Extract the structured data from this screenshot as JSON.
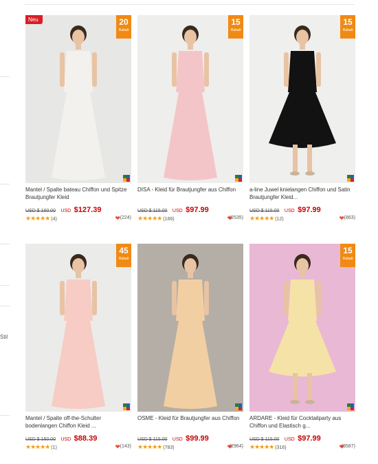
{
  "sidebar": {
    "fragment": "Stil"
  },
  "products": [
    {
      "title": "Mantel / Spalte bateau Chiffon und Spitze Brautjungfer Kleid",
      "old_price": "USD $ 160.00",
      "currency": "USD",
      "price": "$127.39",
      "reviews": "(4)",
      "likes": "(224)",
      "discount": "20",
      "discount_label": "Rabatt",
      "new_label": "Neu",
      "rating": 5,
      "dress_color": "#f3f1ee",
      "bg_color": "#e7e7e5"
    },
    {
      "title": "DISA - Kleid für Brautjungfer aus Chiffon",
      "old_price": "USD $ 115.00",
      "currency": "USD",
      "price": "$97.99",
      "reviews": "(166)",
      "likes": "(2535)",
      "discount": "15",
      "discount_label": "Rabatt",
      "new_label": "",
      "rating": 5,
      "dress_color": "#f4c5c8",
      "bg_color": "#eeeeec"
    },
    {
      "title": "a-line Juwel knielangen Chiffon und Satin Brautjungfer Kleid...",
      "old_price": "USD $ 115.00",
      "currency": "USD",
      "price": "$97.99",
      "reviews": "(12)",
      "likes": "(863)",
      "discount": "15",
      "discount_label": "Rabatt",
      "new_label": "",
      "rating": 5,
      "dress_color": "#121212",
      "bg_color": "#efefed"
    },
    {
      "title": "Mantel / Spalte off-the-Schulter bodenlangen Chiffon Kleid ...",
      "old_price": "USD $ 160.00",
      "currency": "USD",
      "price": "$88.39",
      "reviews": "(1)",
      "likes": "(143)",
      "discount": "45",
      "discount_label": "Rabatt",
      "new_label": "",
      "rating": 5,
      "dress_color": "#f6ccc4",
      "bg_color": "#ebebea"
    },
    {
      "title": "OSME - Kleid für Brautjungfer aus Chiffon",
      "old_price": "USD $ 115.00",
      "currency": "USD",
      "price": "$99.99",
      "reviews": "(783)",
      "likes": "(2964)",
      "discount": "",
      "discount_label": "",
      "new_label": "",
      "rating": 5,
      "dress_color": "#f2cfa3",
      "bg_color": "#b4aea6"
    },
    {
      "title": "ARDARE - Kleid für Cocktailparty aus Chiffon und Elastisch g...",
      "old_price": "USD $ 115.00",
      "currency": "USD",
      "price": "$97.99",
      "reviews": "(316)",
      "likes": "(3587)",
      "discount": "15",
      "discount_label": "Rabatt",
      "new_label": "",
      "rating": 5,
      "dress_color": "#f5e2a6",
      "bg_color": "#e9b8d5"
    }
  ],
  "colors": {
    "accent": "#f08a14",
    "price": "#cc0000",
    "new_tag": "#d81f26",
    "star": "#f39c12",
    "heart": "#e74c3c"
  },
  "icons": {
    "star": "star-icon",
    "heart": "heart-icon",
    "zoom": "zoom-icon"
  }
}
